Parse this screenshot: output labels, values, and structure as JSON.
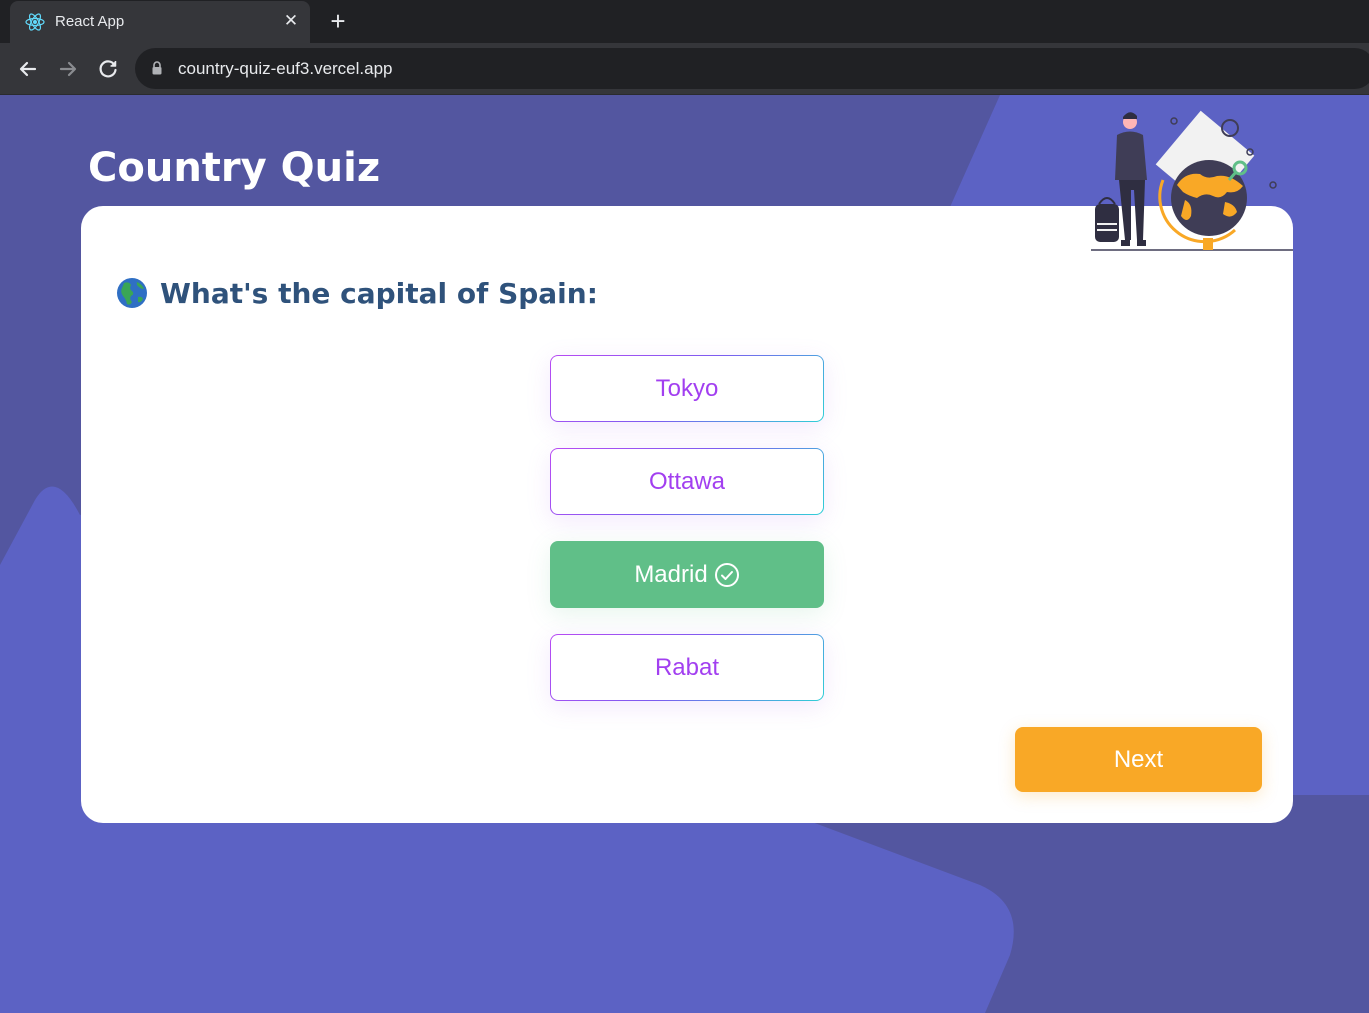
{
  "browser": {
    "tab_title": "React App",
    "url": "country-quiz-euf3.vercel.app",
    "icons": {
      "favicon": "react-logo-icon",
      "close": "close-icon",
      "new_tab": "plus-icon",
      "back": "arrow-left-icon",
      "forward": "arrow-right-icon",
      "reload": "reload-icon",
      "lock": "lock-icon"
    }
  },
  "app": {
    "title": "Country Quiz",
    "question": "What's the capital of Spain:",
    "question_icon": "globe-americas-icon",
    "answers": [
      {
        "label": "Tokyo",
        "state": "default"
      },
      {
        "label": "Ottawa",
        "state": "default"
      },
      {
        "label": "Madrid",
        "state": "correct"
      },
      {
        "label": "Rabat",
        "state": "default"
      }
    ],
    "next_label": "Next",
    "illustration": "traveler-with-globe-illustration"
  },
  "colors": {
    "background": "#5c62c4",
    "background_shape": "#5356a0",
    "title": "#ffffff",
    "question_text": "#2f527b",
    "answer_text": "#a23ff0",
    "correct": "#60bf88",
    "next_button": "#f9a826"
  }
}
